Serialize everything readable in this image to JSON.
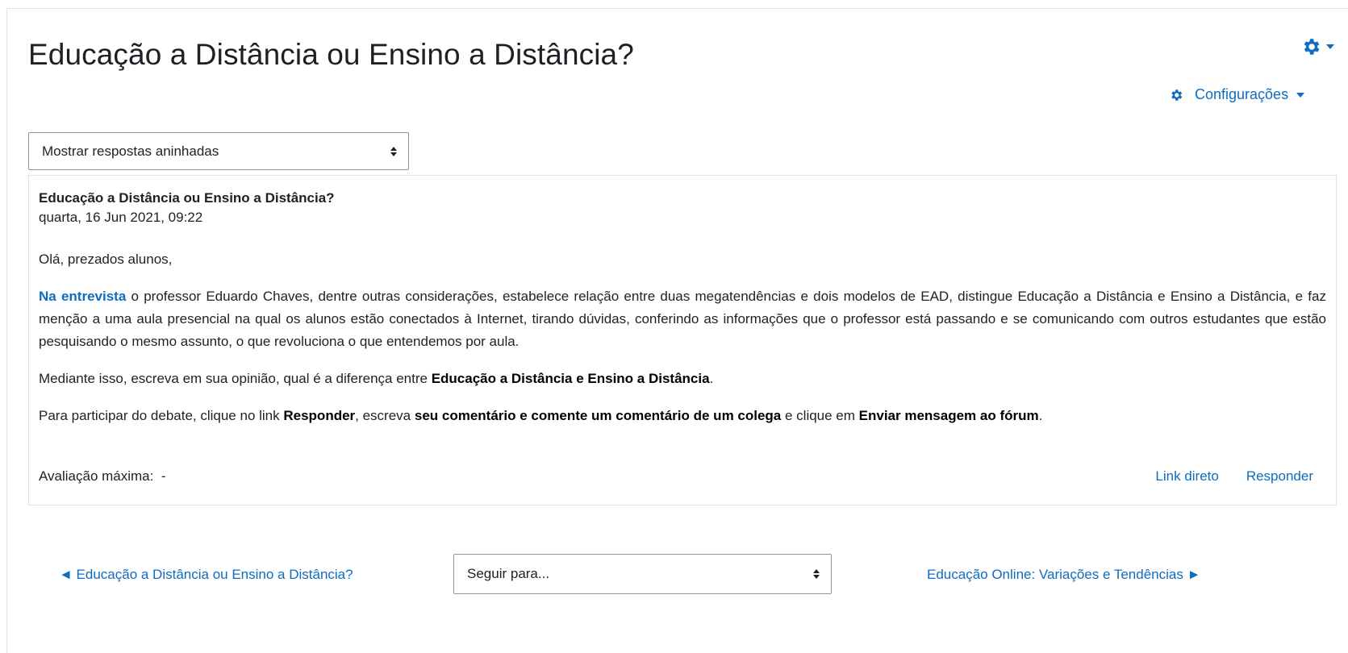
{
  "header": {
    "title": "Educação a Distância ou Ensino a Distância?",
    "settings_label": "Configurações"
  },
  "display_mode": {
    "selected": "Mostrar respostas aninhadas"
  },
  "post": {
    "subject": "Educação a Distância ou Ensino a Distância?",
    "date": "quarta, 16 Jun 2021, 09:22",
    "greeting": "Olá, prezados alunos,",
    "para1_link": "Na entrevista",
    "para1_text": " o professor Eduardo Chaves, dentre outras considerações, estabelece relação entre duas megatendências e dois modelos de EAD, distingue Educação a Distância e Ensino a Distância, e faz menção a uma aula presencial na qual os alunos estão conectados à Internet, tirando dúvidas, conferindo as informações que o professor está passando e se comunicando com outros estudantes que estão pesquisando o mesmo assunto, o que revoluciona o que entendemos por aula.",
    "para2_start": "Mediante isso, escreva em sua opinião, qual é a diferença entre ",
    "para2_bold": "Educação a Distância e Ensino a Distância",
    "para2_end": ".",
    "para3_start": "Para participar do debate, clique no link ",
    "para3_bold1": "Responder",
    "para3_mid1": ", escreva ",
    "para3_bold2": "seu comentário e comente um comentário de um colega",
    "para3_mid2": " e clique em ",
    "para3_bold3": "Enviar mensagem ao fórum",
    "para3_end": ".",
    "rating_label": "Avaliação máxima:",
    "rating_value": "-",
    "permalink_label": "Link direto",
    "reply_label": "Responder"
  },
  "navigation": {
    "prev_label": "◄ Educação a Distância ou Ensino a Distância?",
    "jump_placeholder": "Seguir para...",
    "next_label": "Educação Online: Variações e Tendências ►"
  },
  "colors": {
    "link": "#0f6cbf",
    "text": "#1d2125",
    "border": "#dee2e6"
  }
}
